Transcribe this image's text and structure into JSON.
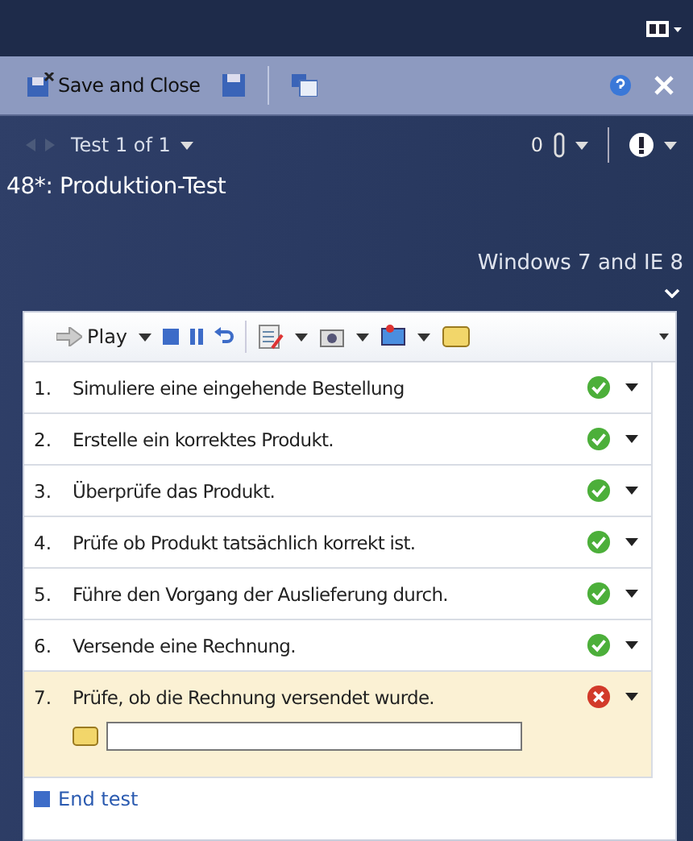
{
  "toolbar": {
    "save_and_close": "Save and Close"
  },
  "test_nav": {
    "label": "Test 1 of 1",
    "attachments_count": "0"
  },
  "title": "48*: Produktion-Test",
  "configuration": "Windows 7 and IE 8",
  "runner_toolbar": {
    "play": "Play"
  },
  "steps": [
    {
      "number": "1.",
      "text": "Simuliere eine eingehende Bestellung",
      "kind": "passed",
      "selected": false
    },
    {
      "number": "2.",
      "text": "Erstelle ein korrektes Produkt.",
      "kind": "passed",
      "selected": false
    },
    {
      "number": "3.",
      "text": "Überprüfe das Produkt.",
      "kind": "passed",
      "selected": false
    },
    {
      "number": "4.",
      "text": "Prüfe ob Produkt tatsächlich korrekt ist.",
      "kind": "passed",
      "selected": false
    },
    {
      "number": "5.",
      "text": "Führe den Vorgang der Auslieferung durch.",
      "kind": "passed",
      "selected": false
    },
    {
      "number": "6.",
      "text": "Versende eine Rechnung.",
      "kind": "passed",
      "selected": false
    },
    {
      "number": "7.",
      "text": "Prüfe, ob die Rechnung versendet wurde.",
      "kind": "failed",
      "selected": true
    }
  ],
  "end_test": "End test"
}
